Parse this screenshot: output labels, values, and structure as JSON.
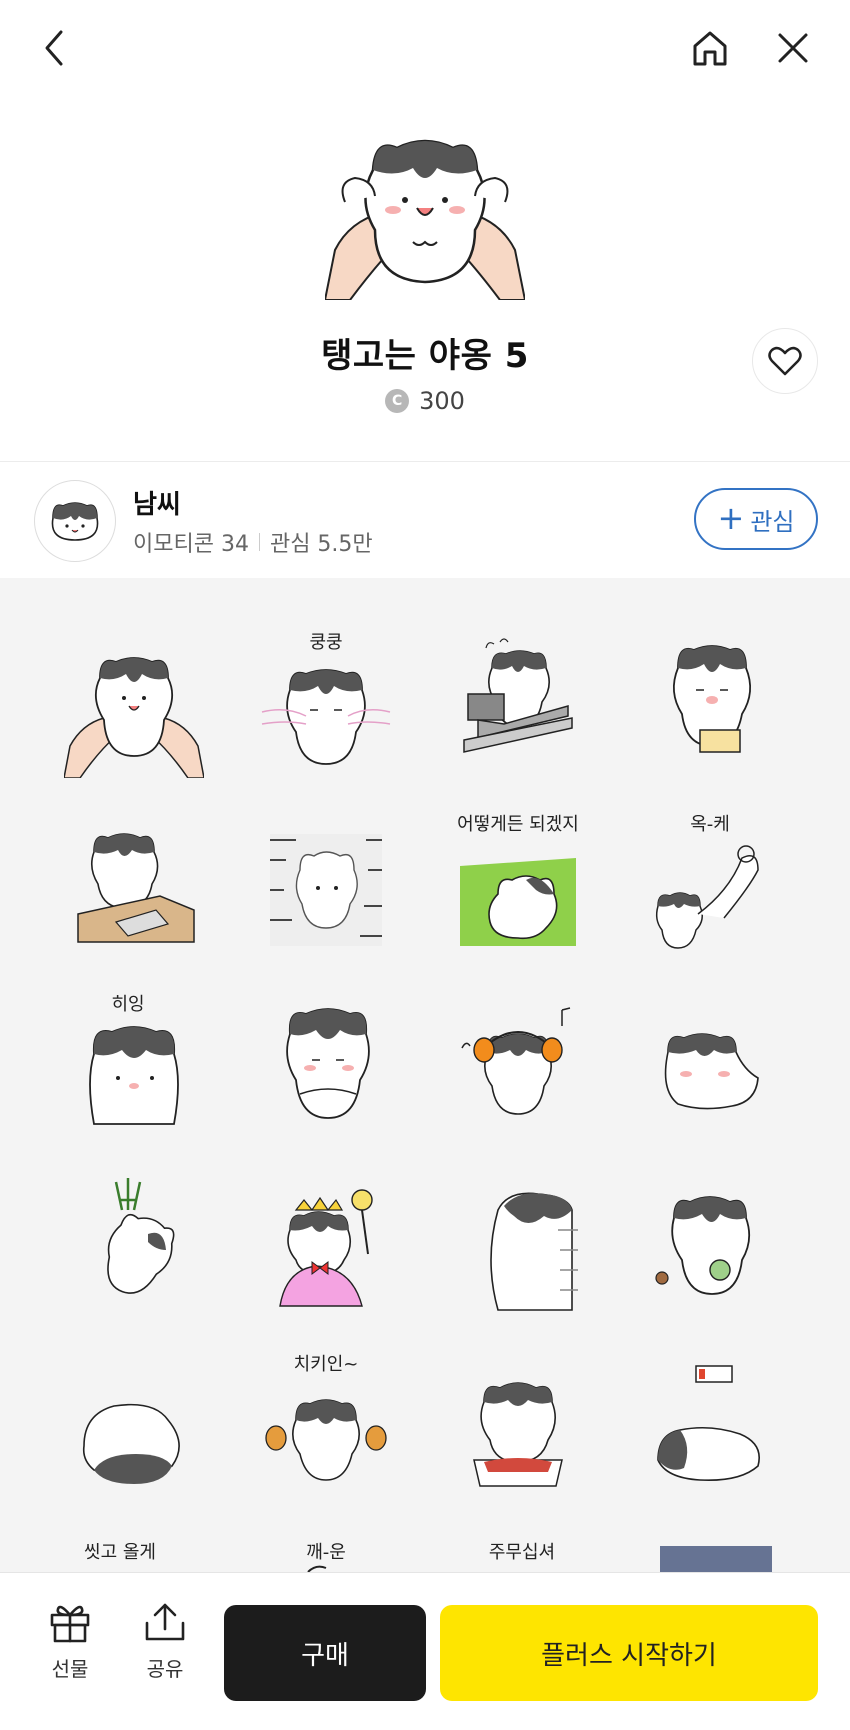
{
  "header": {
    "back_icon": "chevron-left-icon",
    "home_icon": "home-icon",
    "close_icon": "close-icon"
  },
  "product": {
    "title": "탱고는 야옹 5",
    "price": "300",
    "coin_symbol": "C"
  },
  "artist": {
    "name": "남씨",
    "emoticon_count": "이모티콘 34",
    "likes": "관심 5.5만",
    "follow_label": "관심",
    "follow_color": "#2f6fc0"
  },
  "stickers": {
    "captions": [
      "쿵쿵",
      "어떻게든 되겠지",
      "옥-케",
      "히잉",
      "치키인~",
      "씻고 올게",
      "깨-운",
      "주무십셔"
    ]
  },
  "bottom": {
    "gift_label": "선물",
    "share_label": "공유",
    "buy_label": "구매",
    "plus_label": "플러스 시작하기",
    "plus_color": "#fee500"
  }
}
